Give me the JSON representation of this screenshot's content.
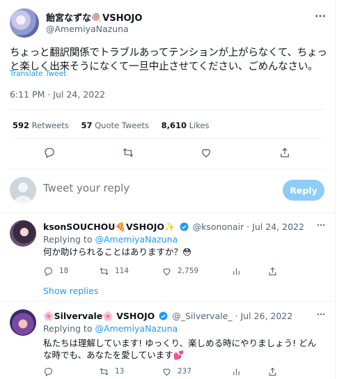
{
  "tweet": {
    "display_name": "飴宮なずな🍭VSHOJO",
    "handle": "@AmemiyaNazuna",
    "text": "ちょっと翻訳関係でトラブルあってテンションが上がらなくて、ちょっと楽しく出来そうになくて一旦中止させてください、ごめんなさい。",
    "translate_label": "Translate Tweet",
    "timestamp": "6:11 PM · Jul 24, 2022",
    "stats": {
      "retweets_count": "592",
      "retweets_label": "Retweets",
      "quotes_count": "57",
      "quotes_label": "Quote Tweets",
      "likes_count": "8,610",
      "likes_label": "Likes"
    }
  },
  "composer": {
    "placeholder": "Tweet your reply",
    "button_label": "Reply"
  },
  "replies": [
    {
      "display_name": "ksonSOUCHOU🍕VSHOJO✨",
      "handle": "@ksononair",
      "date": "Jul 24, 2022",
      "replying_prefix": "Replying to",
      "replying_to": "@AmemiyaNazuna",
      "text": "何か助けられることはありますか？😳",
      "replies": "18",
      "retweets": "114",
      "likes": "2,759",
      "show_replies": "Show replies"
    },
    {
      "display_name": "🌸Silvervale🌸 VSHOJO",
      "handle": "@_Silvervale_",
      "date": "Jul 26, 2022",
      "replying_prefix": "Replying to",
      "replying_to": "@AmemiyaNazuna",
      "text": "私たちは理解しています! ゆっくり、楽しめる時にやりましょう! どんな時でも、あなたを愛しています💕",
      "replies": "",
      "retweets": "13",
      "likes": "237"
    }
  ],
  "colors": {
    "accent": "#1d9bf0",
    "reply_button": "#8ecdf8",
    "muted_text": "#536471",
    "divider": "#eff3f4"
  }
}
